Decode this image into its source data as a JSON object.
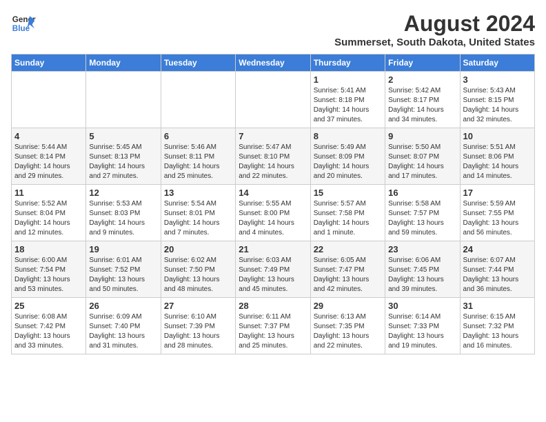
{
  "header": {
    "logo_line1": "General",
    "logo_line2": "Blue",
    "title": "August 2024",
    "subtitle": "Summerset, South Dakota, United States"
  },
  "weekdays": [
    "Sunday",
    "Monday",
    "Tuesday",
    "Wednesday",
    "Thursday",
    "Friday",
    "Saturday"
  ],
  "weeks": [
    [
      {
        "day": "",
        "info": ""
      },
      {
        "day": "",
        "info": ""
      },
      {
        "day": "",
        "info": ""
      },
      {
        "day": "",
        "info": ""
      },
      {
        "day": "1",
        "info": "Sunrise: 5:41 AM\nSunset: 8:18 PM\nDaylight: 14 hours\nand 37 minutes."
      },
      {
        "day": "2",
        "info": "Sunrise: 5:42 AM\nSunset: 8:17 PM\nDaylight: 14 hours\nand 34 minutes."
      },
      {
        "day": "3",
        "info": "Sunrise: 5:43 AM\nSunset: 8:15 PM\nDaylight: 14 hours\nand 32 minutes."
      }
    ],
    [
      {
        "day": "4",
        "info": "Sunrise: 5:44 AM\nSunset: 8:14 PM\nDaylight: 14 hours\nand 29 minutes."
      },
      {
        "day": "5",
        "info": "Sunrise: 5:45 AM\nSunset: 8:13 PM\nDaylight: 14 hours\nand 27 minutes."
      },
      {
        "day": "6",
        "info": "Sunrise: 5:46 AM\nSunset: 8:11 PM\nDaylight: 14 hours\nand 25 minutes."
      },
      {
        "day": "7",
        "info": "Sunrise: 5:47 AM\nSunset: 8:10 PM\nDaylight: 14 hours\nand 22 minutes."
      },
      {
        "day": "8",
        "info": "Sunrise: 5:49 AM\nSunset: 8:09 PM\nDaylight: 14 hours\nand 20 minutes."
      },
      {
        "day": "9",
        "info": "Sunrise: 5:50 AM\nSunset: 8:07 PM\nDaylight: 14 hours\nand 17 minutes."
      },
      {
        "day": "10",
        "info": "Sunrise: 5:51 AM\nSunset: 8:06 PM\nDaylight: 14 hours\nand 14 minutes."
      }
    ],
    [
      {
        "day": "11",
        "info": "Sunrise: 5:52 AM\nSunset: 8:04 PM\nDaylight: 14 hours\nand 12 minutes."
      },
      {
        "day": "12",
        "info": "Sunrise: 5:53 AM\nSunset: 8:03 PM\nDaylight: 14 hours\nand 9 minutes."
      },
      {
        "day": "13",
        "info": "Sunrise: 5:54 AM\nSunset: 8:01 PM\nDaylight: 14 hours\nand 7 minutes."
      },
      {
        "day": "14",
        "info": "Sunrise: 5:55 AM\nSunset: 8:00 PM\nDaylight: 14 hours\nand 4 minutes."
      },
      {
        "day": "15",
        "info": "Sunrise: 5:57 AM\nSunset: 7:58 PM\nDaylight: 14 hours\nand 1 minute."
      },
      {
        "day": "16",
        "info": "Sunrise: 5:58 AM\nSunset: 7:57 PM\nDaylight: 13 hours\nand 59 minutes."
      },
      {
        "day": "17",
        "info": "Sunrise: 5:59 AM\nSunset: 7:55 PM\nDaylight: 13 hours\nand 56 minutes."
      }
    ],
    [
      {
        "day": "18",
        "info": "Sunrise: 6:00 AM\nSunset: 7:54 PM\nDaylight: 13 hours\nand 53 minutes."
      },
      {
        "day": "19",
        "info": "Sunrise: 6:01 AM\nSunset: 7:52 PM\nDaylight: 13 hours\nand 50 minutes."
      },
      {
        "day": "20",
        "info": "Sunrise: 6:02 AM\nSunset: 7:50 PM\nDaylight: 13 hours\nand 48 minutes."
      },
      {
        "day": "21",
        "info": "Sunrise: 6:03 AM\nSunset: 7:49 PM\nDaylight: 13 hours\nand 45 minutes."
      },
      {
        "day": "22",
        "info": "Sunrise: 6:05 AM\nSunset: 7:47 PM\nDaylight: 13 hours\nand 42 minutes."
      },
      {
        "day": "23",
        "info": "Sunrise: 6:06 AM\nSunset: 7:45 PM\nDaylight: 13 hours\nand 39 minutes."
      },
      {
        "day": "24",
        "info": "Sunrise: 6:07 AM\nSunset: 7:44 PM\nDaylight: 13 hours\nand 36 minutes."
      }
    ],
    [
      {
        "day": "25",
        "info": "Sunrise: 6:08 AM\nSunset: 7:42 PM\nDaylight: 13 hours\nand 33 minutes."
      },
      {
        "day": "26",
        "info": "Sunrise: 6:09 AM\nSunset: 7:40 PM\nDaylight: 13 hours\nand 31 minutes."
      },
      {
        "day": "27",
        "info": "Sunrise: 6:10 AM\nSunset: 7:39 PM\nDaylight: 13 hours\nand 28 minutes."
      },
      {
        "day": "28",
        "info": "Sunrise: 6:11 AM\nSunset: 7:37 PM\nDaylight: 13 hours\nand 25 minutes."
      },
      {
        "day": "29",
        "info": "Sunrise: 6:13 AM\nSunset: 7:35 PM\nDaylight: 13 hours\nand 22 minutes."
      },
      {
        "day": "30",
        "info": "Sunrise: 6:14 AM\nSunset: 7:33 PM\nDaylight: 13 hours\nand 19 minutes."
      },
      {
        "day": "31",
        "info": "Sunrise: 6:15 AM\nSunset: 7:32 PM\nDaylight: 13 hours\nand 16 minutes."
      }
    ]
  ]
}
